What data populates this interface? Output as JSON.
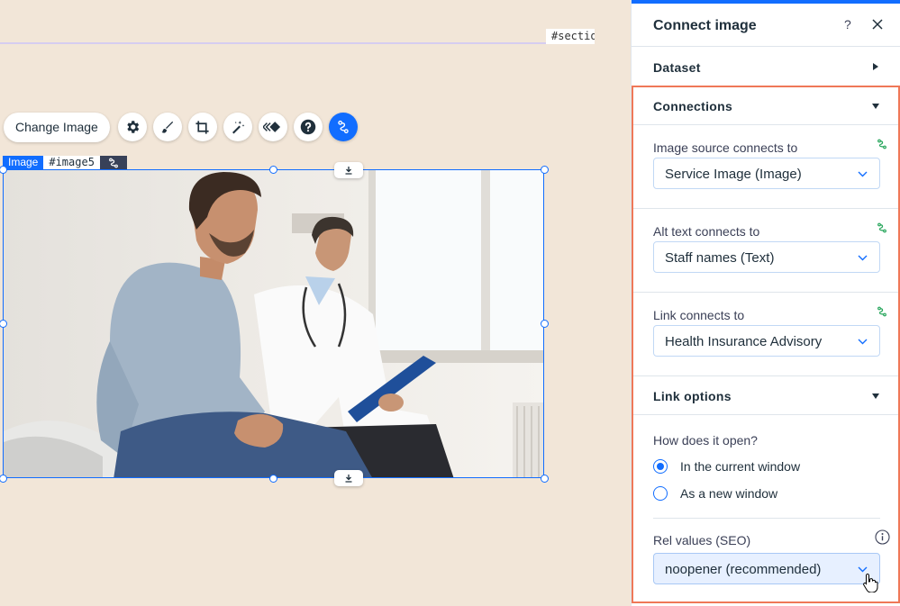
{
  "canvas": {
    "section_tag": "#sectio",
    "toolbar": {
      "change_image_label": "Change Image",
      "tools": [
        "gear-icon",
        "brush-icon",
        "crop-icon",
        "magic-wand-icon",
        "animation-icon",
        "help-icon",
        "connect-data-icon"
      ]
    },
    "element_label": {
      "type": "Image",
      "id": "#image5"
    }
  },
  "panel": {
    "title": "Connect image",
    "help": "?",
    "dataset_section": "Dataset",
    "connections_section": "Connections",
    "fields": [
      {
        "label": "Image source connects to",
        "value": "Service Image (Image)"
      },
      {
        "label": "Alt text connects to",
        "value": "Staff names (Text)"
      },
      {
        "label": "Link connects to",
        "value": "Health Insurance Advisory"
      }
    ],
    "link_options": {
      "title": "Link options",
      "question": "How does it open?",
      "options": [
        {
          "label": "In the current window",
          "checked": true
        },
        {
          "label": "As a new window",
          "checked": false
        }
      ],
      "rel_label": "Rel values (SEO)",
      "rel_value": "noopener (recommended)"
    }
  },
  "colors": {
    "accent": "#116dff",
    "highlight_border": "#ef7858",
    "connected_icon": "#25a55a",
    "canvas_background": "#f2e6d8"
  }
}
